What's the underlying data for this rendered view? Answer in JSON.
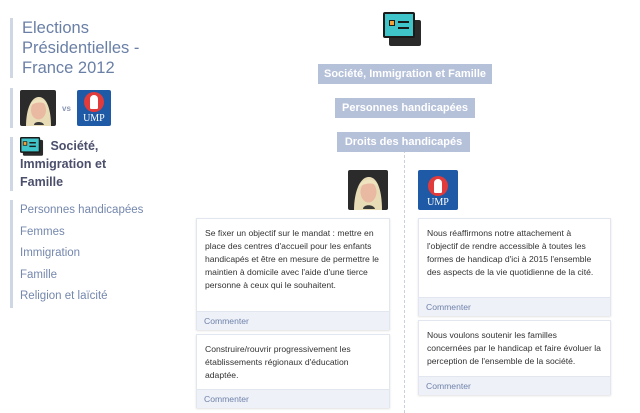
{
  "sidebar": {
    "title_lines": [
      "Elections",
      "Présidentielles -",
      "France 2012"
    ],
    "vs_label": "vs",
    "party_label": "UMP",
    "active_category": [
      "Société,",
      "Immigration et",
      "Famille"
    ],
    "items": [
      "Personnes handicapées",
      "Femmes",
      "Immigration",
      "Famille",
      "Religion et laïcité"
    ]
  },
  "main": {
    "category_icon": "category-icon",
    "breadcrumbs": [
      "Société, Immigration et Famille",
      "Personnes handicapées",
      "Droits des handicapés"
    ],
    "left": {
      "cards": [
        {
          "text": "Se fixer un objectif sur le mandat : mettre en place des centres d'accueil pour les enfants handicapés et être en mesure de permettre le maintien à domicile avec l'aide d'une tierce personne à ceux qui le souhaitent.",
          "comment_label": "Commenter"
        },
        {
          "text": "Construire/rouvrir progressivement les établissements régionaux d'éducation adaptée.",
          "comment_label": "Commenter"
        }
      ]
    },
    "right": {
      "party_label": "UMP",
      "cards": [
        {
          "text": "Nous réaffirmons notre attachement à l'objectif de rendre accessible à toutes les formes de handicap d'ici à 2015 l'ensemble des aspects de la vie quotidienne de la cité.",
          "comment_label": "Commenter"
        },
        {
          "text": "Nous voulons soutenir les familles concernées par le handicap et faire évoluer la perception de l'ensemble de la société.",
          "comment_label": "Commenter"
        }
      ]
    }
  },
  "colors": {
    "accent": "#b5c0d9",
    "link": "#7487ad",
    "party_blue": "#1f5aa6",
    "party_red": "#e23b3b"
  }
}
